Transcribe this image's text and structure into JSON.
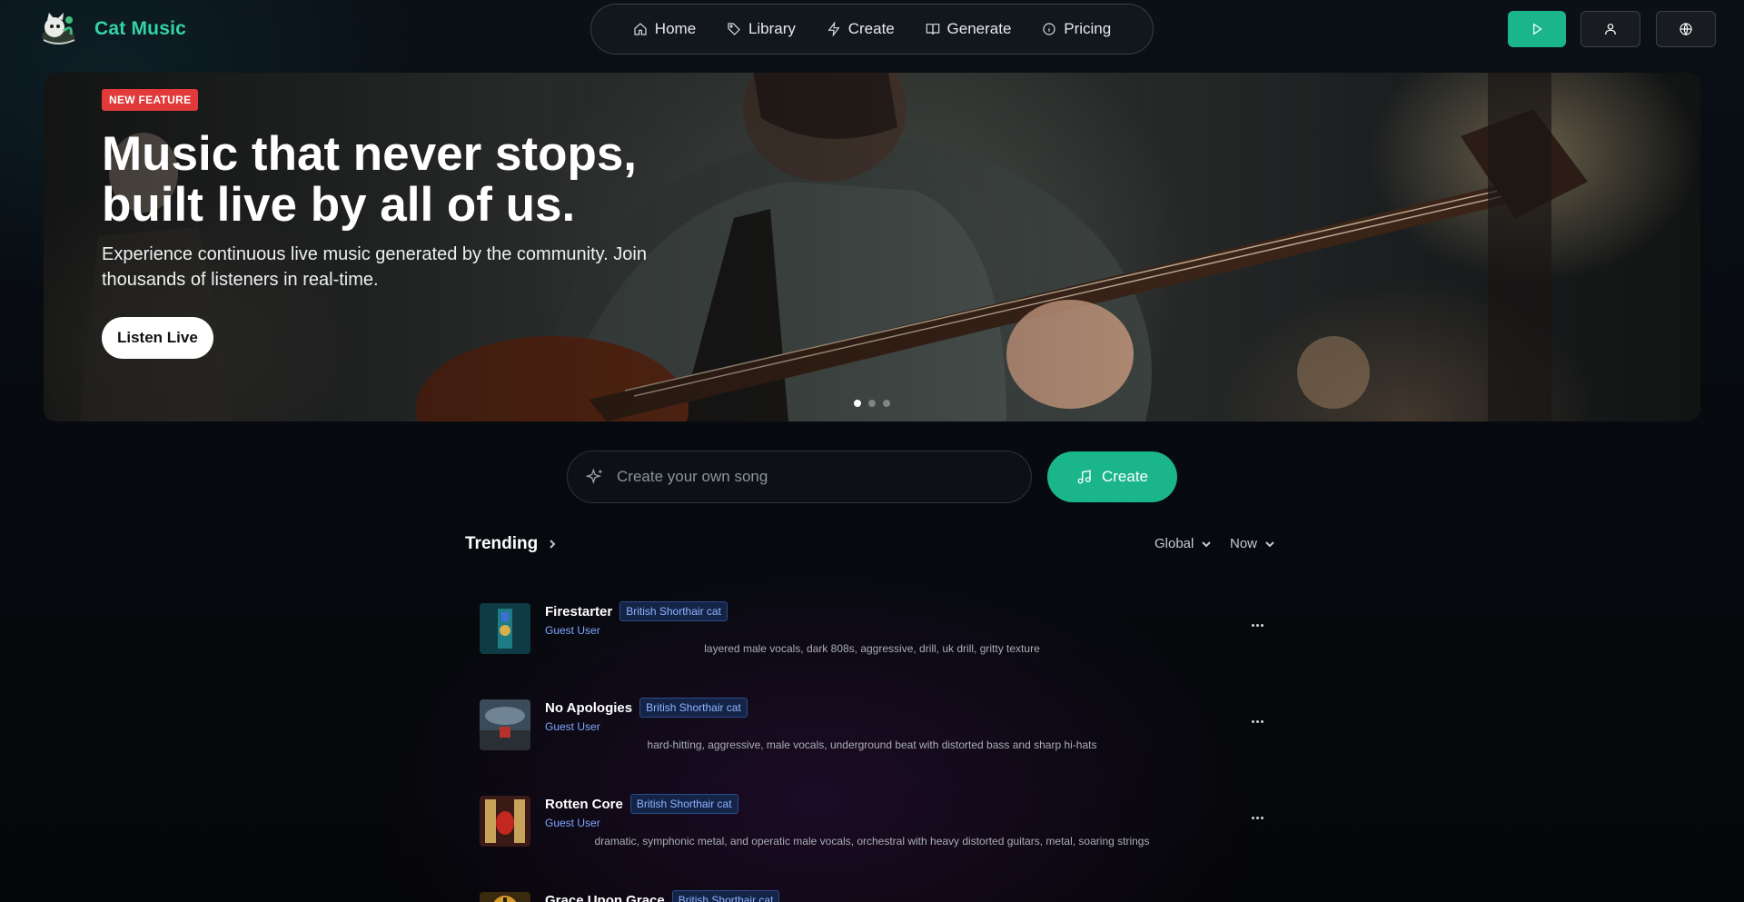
{
  "header": {
    "brand": "Cat Music",
    "nav": [
      {
        "label": "Home",
        "icon": "home-icon"
      },
      {
        "label": "Library",
        "icon": "tag-icon"
      },
      {
        "label": "Create",
        "icon": "bolt-icon"
      },
      {
        "label": "Generate",
        "icon": "book-icon"
      },
      {
        "label": "Pricing",
        "icon": "info-icon"
      }
    ],
    "actions": [
      {
        "icon": "play-icon"
      },
      {
        "icon": "user-icon"
      },
      {
        "icon": "globe-icon"
      }
    ]
  },
  "hero": {
    "badge": "NEW FEATURE",
    "title_line1": "Music that never stops,",
    "title_line2": "built live by all of us.",
    "subtitle": "Experience continuous live music generated by the community. Join thousands of listeners in real-time.",
    "cta": "Listen Live",
    "slides": 3,
    "active_slide": 1
  },
  "create": {
    "placeholder": "Create your own song",
    "button": "Create"
  },
  "trending": {
    "title": "Trending",
    "filters": {
      "region": "Global",
      "period": "Now"
    },
    "tracks": [
      {
        "title": "Firestarter",
        "tag": "British Shorthair cat",
        "user": "Guest User",
        "desc": "layered male vocals, dark 808s, aggressive, drill, uk drill, gritty texture"
      },
      {
        "title": "No Apologies",
        "tag": "British Shorthair cat",
        "user": "Guest User",
        "desc": "hard-hitting, aggressive, male vocals, underground beat with distorted bass and sharp hi-hats"
      },
      {
        "title": "Rotten Core",
        "tag": "British Shorthair cat",
        "user": "Guest User",
        "desc": "dramatic, symphonic metal, and operatic male vocals, orchestral with heavy distorted guitars, metal, soaring strings"
      },
      {
        "title": "Grace Upon Grace",
        "tag": "British Shorthair cat",
        "user": "",
        "desc": ""
      }
    ]
  },
  "colors": {
    "accent": "#1bb58b",
    "brand": "#34d3a6",
    "badge": "#e23a3a",
    "tag_text": "#8fb3ff"
  }
}
